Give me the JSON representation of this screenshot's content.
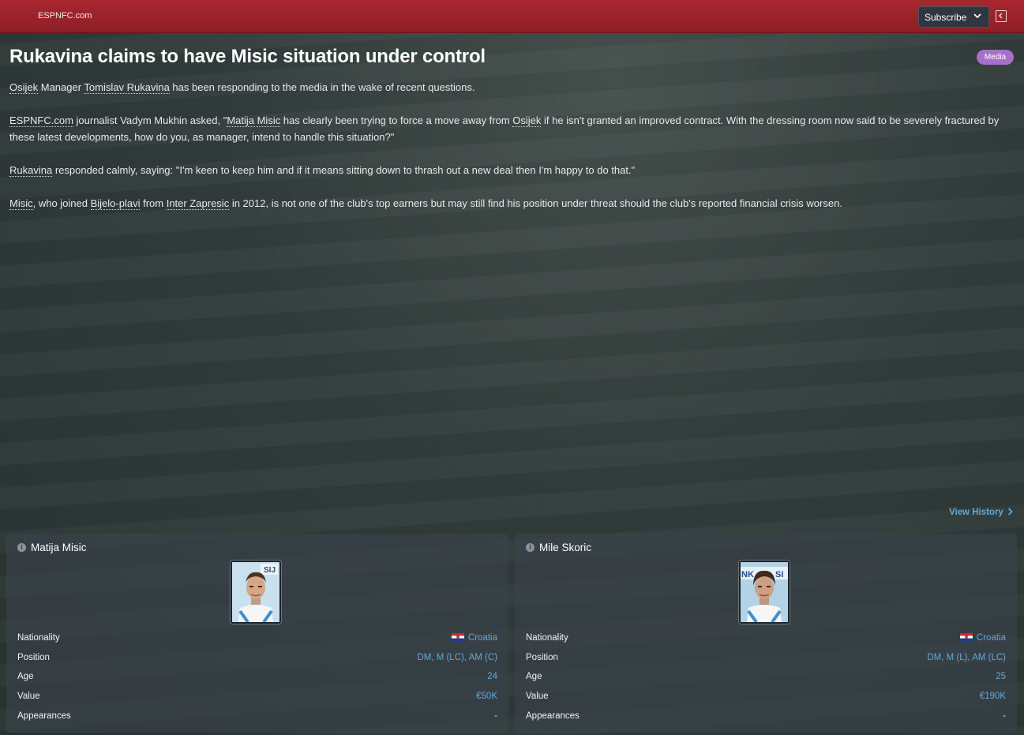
{
  "header": {
    "source": "ESPNFC.com",
    "subscribe_label": "Subscribe",
    "badge": "Media"
  },
  "article": {
    "headline": "Rukavina claims to have Misic situation under control",
    "p1": {
      "link1": "Osijek",
      "t1": " Manager ",
      "link2": "Tomislav Rukavina",
      "t2": " has been responding to the media in the wake of recent questions."
    },
    "p2": {
      "link1": "ESPNFC.com",
      "t1": " journalist Vadym Mukhin asked, \"",
      "link2": "Matija Misic",
      "t2": " has clearly been trying to force a move away from ",
      "link3": "Osijek",
      "t3": " if he isn't granted an improved contract. With the dressing room now said to be severely fractured by these latest developments, how do you, as manager, intend to handle this situation?\""
    },
    "p3": {
      "link1": "Rukavina",
      "t1": " responded calmly, saying: \"I'm keen to keep him and if it means sitting down to thrash out a new deal then I'm happy to do that.\""
    },
    "p4": {
      "link1": "Misic",
      "t1": ", who joined ",
      "link2": "Bijelo-plavi",
      "t2": " from ",
      "link3": "Inter Zapresic",
      "t3": " in 2012, is not one of the club's top earners but may still find his position under threat should the club's reported financial crisis worsen."
    },
    "view_history": "View History"
  },
  "labels": {
    "nationality": "Nationality",
    "position": "Position",
    "age": "Age",
    "value": "Value",
    "appearances": "Appearances"
  },
  "players": [
    {
      "name": "Matija Misic",
      "nationality": "Croatia",
      "position": "DM, M (LC), AM (C)",
      "age": "24",
      "value": "€50K",
      "appearances": "-"
    },
    {
      "name": "Mile Skoric",
      "nationality": "Croatia",
      "position": "DM, M (L), AM (LC)",
      "age": "25",
      "value": "€190K",
      "appearances": "-"
    }
  ],
  "colors": {
    "topbar": "#a8272f",
    "badge": "#a770c8",
    "link": "#62a9dc"
  },
  "icons": [
    "chevron-down-icon",
    "collapse-panel-icon",
    "info-icon",
    "chevron-right-icon",
    "croatia-flag-icon"
  ]
}
